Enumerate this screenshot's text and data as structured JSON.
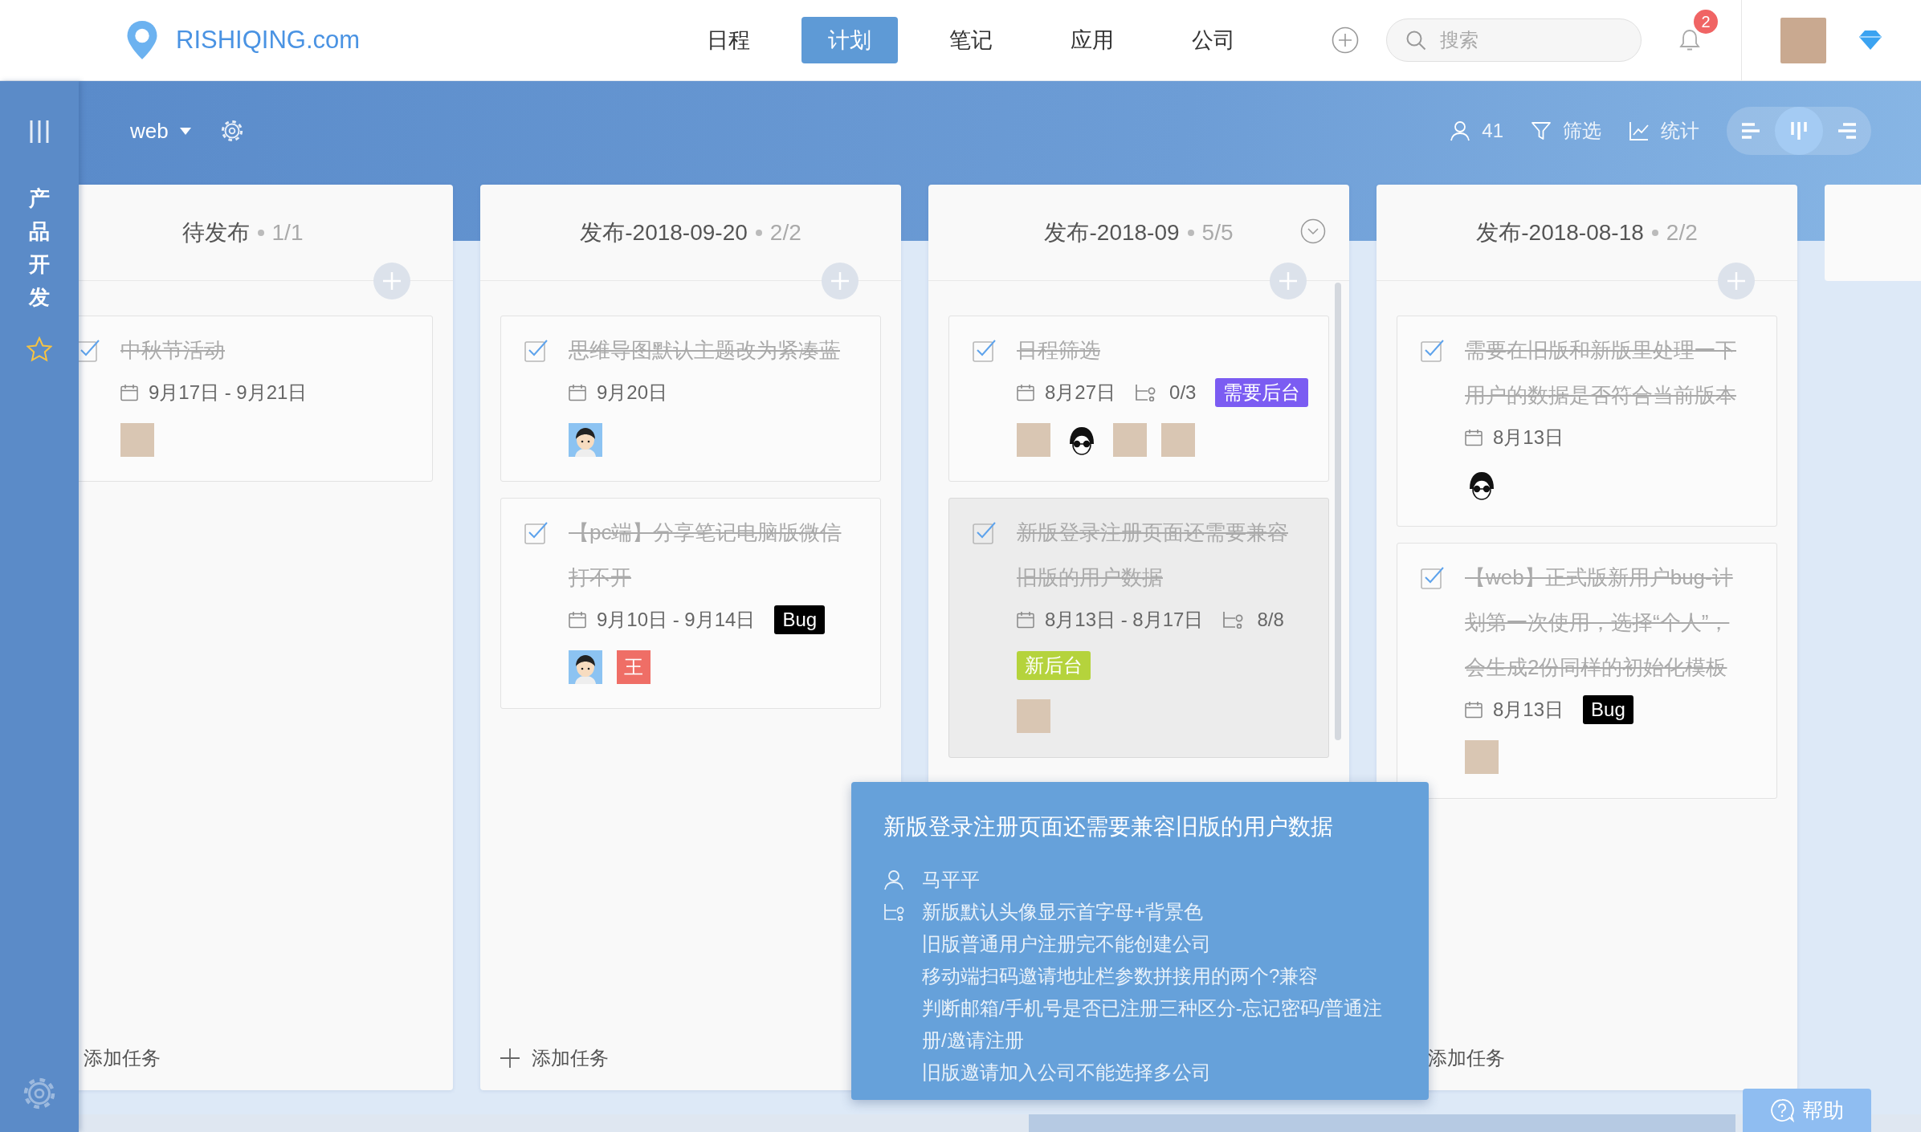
{
  "header": {
    "logo": "RISHIQING.com",
    "nav": [
      {
        "label": "日程",
        "selected": false
      },
      {
        "label": "计划",
        "selected": true
      },
      {
        "label": "笔记",
        "selected": false
      },
      {
        "label": "应用",
        "selected": false
      },
      {
        "label": "公司",
        "selected": false
      }
    ],
    "search": {
      "placeholder": "搜索"
    },
    "notification_count": "2"
  },
  "sidebar": {
    "project": "产品开发",
    "starred": true
  },
  "toolbar": {
    "project_filter": "web",
    "members": "41",
    "filter": "筛选",
    "stats": "统计",
    "view_modes": [
      {
        "kind": "list",
        "selected": false
      },
      {
        "kind": "board",
        "selected": true
      },
      {
        "kind": "timeline",
        "selected": false
      }
    ]
  },
  "board": {
    "columns": [
      {
        "title": "待发布",
        "count": "1/1",
        "collapse_toggle": false,
        "scrollbar": false,
        "cards": [
          {
            "title": "中秋节活动",
            "checked": true,
            "hovered": false,
            "date": "9月17日 - 9月21日",
            "avatars": [
              {
                "kind": "photo"
              }
            ]
          }
        ],
        "footer": {
          "label": "添加任务"
        }
      },
      {
        "title": "发布-2018-09-20",
        "count": "2/2",
        "collapse_toggle": false,
        "scrollbar": false,
        "cards": [
          {
            "title": "思维导图默认主题改为紧凑蓝",
            "checked": true,
            "hovered": false,
            "date": "9月20日",
            "avatars": [
              {
                "kind": "cartoon"
              }
            ]
          },
          {
            "title": "【pc端】分享笔记电脑版微信打不开",
            "checked": true,
            "hovered": false,
            "date": "9月10日 - 9月14日",
            "tags": [
              {
                "label": "Bug",
                "color": "#000000"
              }
            ],
            "avatars": [
              {
                "kind": "cartoon"
              },
              {
                "kind": "initial",
                "text": "王"
              }
            ]
          }
        ],
        "footer": {
          "label": "添加任务",
          "add_icon": true
        }
      },
      {
        "title": "发布-2018-09",
        "count": "5/5",
        "collapse_toggle": true,
        "scrollbar": true,
        "cards": [
          {
            "title": "日程筛选",
            "checked": true,
            "hovered": false,
            "date": "8月27日",
            "subtasks": "0/3",
            "tags": [
              {
                "label": "需要后台",
                "color": "#7b5cf2"
              }
            ],
            "avatars": [
              {
                "kind": "photo"
              },
              {
                "kind": "glasses"
              },
              {
                "kind": "photo"
              },
              {
                "kind": "photo"
              }
            ]
          },
          {
            "title": "新版登录注册页面还需要兼容旧版的用户数据",
            "checked": true,
            "hovered": true,
            "date": "8月13日 - 8月17日",
            "subtasks": "8/8",
            "tags": [
              {
                "label": "新后台",
                "color": "#b5d33c"
              }
            ],
            "avatars": [
              {
                "kind": "photo"
              }
            ]
          }
        ]
      },
      {
        "title": "发布-2018-08-18",
        "count": "2/2",
        "collapse_toggle": false,
        "scrollbar": false,
        "cards": [
          {
            "title": "需要在旧版和新版里处理一下用户的数据是否符合当前版本",
            "checked": true,
            "hovered": false,
            "date": "8月13日",
            "avatars": [
              {
                "kind": "glasses"
              }
            ]
          },
          {
            "title": "【web】正式版新用户bug-计划第一次使用，选择“个人”，会生成2份同样的初始化模板",
            "checked": true,
            "hovered": false,
            "date": "8月13日",
            "tags": [
              {
                "label": "Bug",
                "color": "#000000"
              }
            ],
            "avatars": [
              {
                "kind": "photo"
              }
            ]
          }
        ],
        "footer": {
          "label": "添加任务"
        }
      }
    ],
    "next_column_peek": true
  },
  "tooltip": {
    "title": "新版登录注册页面还需要兼容旧版的用户数据",
    "assignee": "马平平",
    "subtasks": [
      "新版默认头像显示首字母+背景色",
      "旧版普通用户注册完不能创建公司",
      "移动端扫码邀请地址栏参数拼接用的两个?兼容",
      "判断邮箱/手机号是否已注册三种区分-忘记密码/普通注册/邀请注册",
      "旧版邀请加入公司不能选择多公司"
    ]
  },
  "help": "帮助"
}
